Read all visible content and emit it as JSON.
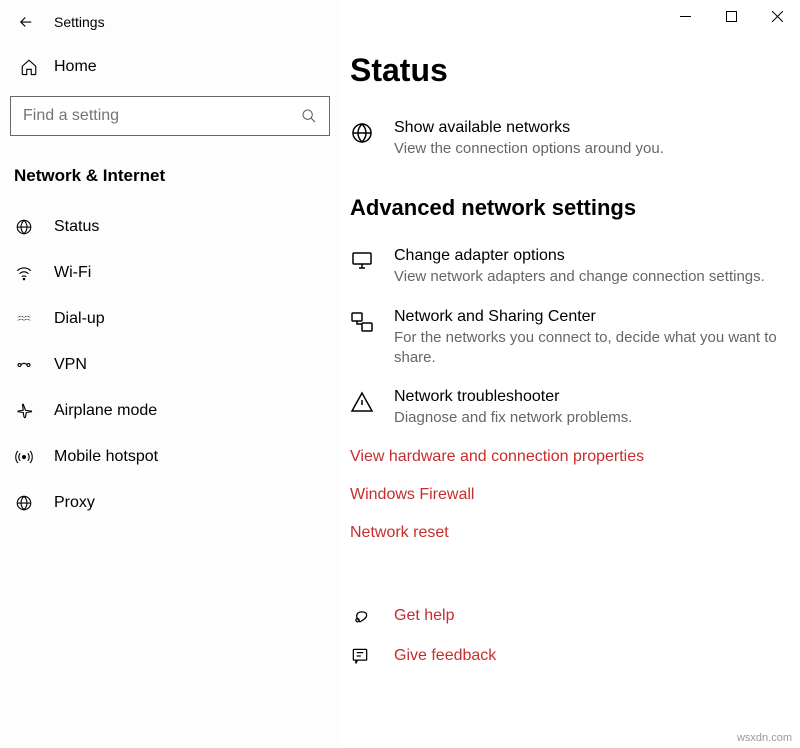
{
  "window": {
    "title": "Settings"
  },
  "sidebar": {
    "home_label": "Home",
    "search_placeholder": "Find a setting",
    "category": "Network & Internet",
    "items": [
      {
        "label": "Status"
      },
      {
        "label": "Wi-Fi"
      },
      {
        "label": "Dial-up"
      },
      {
        "label": "VPN"
      },
      {
        "label": "Airplane mode"
      },
      {
        "label": "Mobile hotspot"
      },
      {
        "label": "Proxy"
      }
    ]
  },
  "main": {
    "page_title": "Status",
    "show_networks": {
      "title": "Show available networks",
      "desc": "View the connection options around you."
    },
    "section_title": "Advanced network settings",
    "adapter": {
      "title": "Change adapter options",
      "desc": "View network adapters and change connection settings."
    },
    "sharing": {
      "title": "Network and Sharing Center",
      "desc": "For the networks you connect to, decide what you want to share."
    },
    "troubleshooter": {
      "title": "Network troubleshooter",
      "desc": "Diagnose and fix network problems."
    },
    "links": {
      "hardware": "View hardware and connection properties",
      "firewall": "Windows Firewall",
      "reset": "Network reset",
      "help": "Get help",
      "feedback": "Give feedback"
    }
  },
  "watermark": "wsxdn.com"
}
